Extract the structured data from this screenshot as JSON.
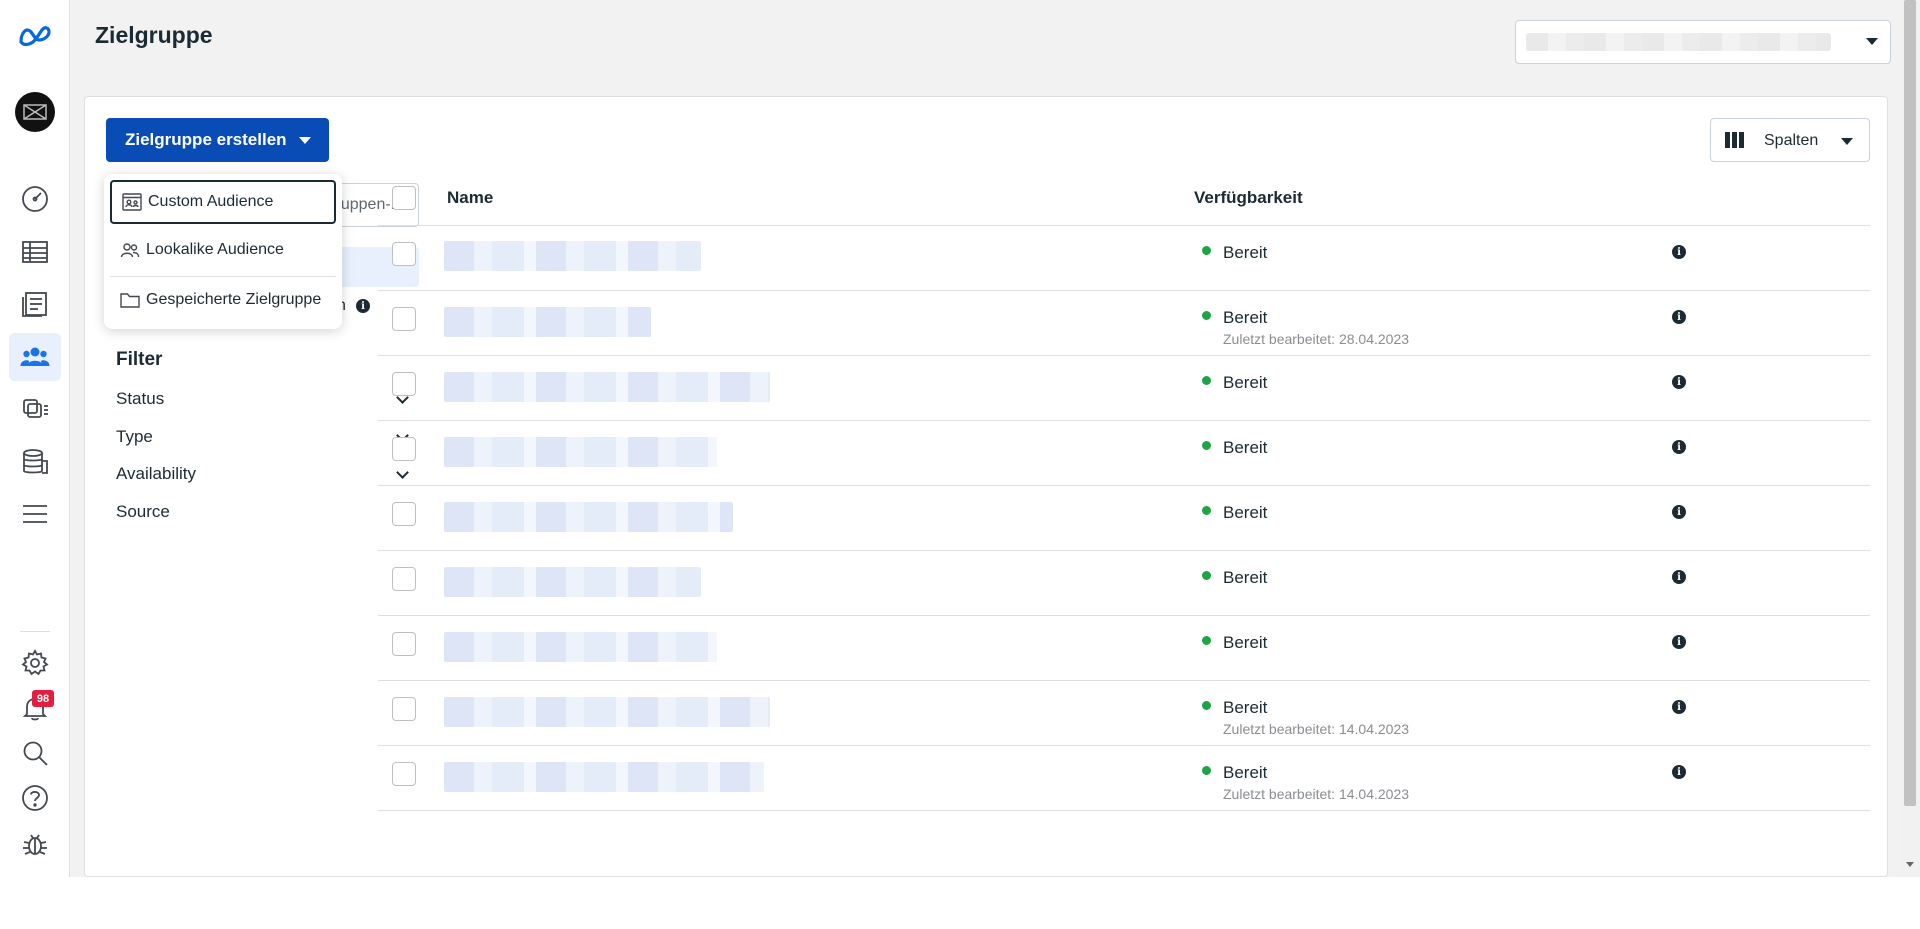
{
  "nav": {
    "items": [
      {
        "name": "meta-logo-icon"
      },
      {
        "name": "account-avatar"
      },
      {
        "name": "dashboard-icon"
      },
      {
        "name": "table-icon"
      },
      {
        "name": "reports-icon"
      },
      {
        "name": "audiences-icon",
        "active": true
      },
      {
        "name": "catalog-icon"
      },
      {
        "name": "data-sources-icon"
      },
      {
        "name": "menu-icon"
      },
      {
        "name": "settings-icon"
      },
      {
        "name": "notifications-icon"
      },
      {
        "name": "search-icon"
      },
      {
        "name": "help-icon"
      },
      {
        "name": "bug-report-icon"
      }
    ],
    "notifications_count": "98"
  },
  "header": {
    "title": "Zielgruppe"
  },
  "toolbar": {
    "create_label": "Zielgruppe erstellen",
    "columns_label": "Spalten"
  },
  "dropdown": {
    "items": [
      {
        "label": "Custom Audience",
        "icon": "custom-audience-icon"
      },
      {
        "label": "Lookalike Audience",
        "icon": "lookalike-people-icon"
      },
      {
        "label": "Gespeicherte Zielgruppe",
        "icon": "folder-icon"
      }
    ]
  },
  "sidebar": {
    "search_partial": "uppen-...",
    "partial_row_text": "n",
    "filter_title": "Filter",
    "filters": [
      {
        "label": "Status"
      },
      {
        "label": "Type"
      },
      {
        "label": "Availability"
      },
      {
        "label": "Source"
      }
    ]
  },
  "table": {
    "headers": {
      "name": "Name",
      "availability": "Verfügbarkeit"
    },
    "rows": [
      {
        "status": "Bereit",
        "sub": ""
      },
      {
        "status": "Bereit",
        "sub": "Zuletzt bearbeitet: 28.04.2023"
      },
      {
        "status": "Bereit",
        "sub": ""
      },
      {
        "status": "Bereit",
        "sub": ""
      },
      {
        "status": "Bereit",
        "sub": ""
      },
      {
        "status": "Bereit",
        "sub": ""
      },
      {
        "status": "Bereit",
        "sub": ""
      },
      {
        "status": "Bereit",
        "sub": "Zuletzt bearbeitet: 14.04.2023"
      },
      {
        "status": "Bereit",
        "sub": "Zuletzt bearbeitet: 14.04.2023"
      }
    ]
  },
  "colors": {
    "primary_button": "#0a4cb6",
    "active_nav": "#1b74e4",
    "status_ready": "#1ea446",
    "badge": "#e41e3f"
  }
}
